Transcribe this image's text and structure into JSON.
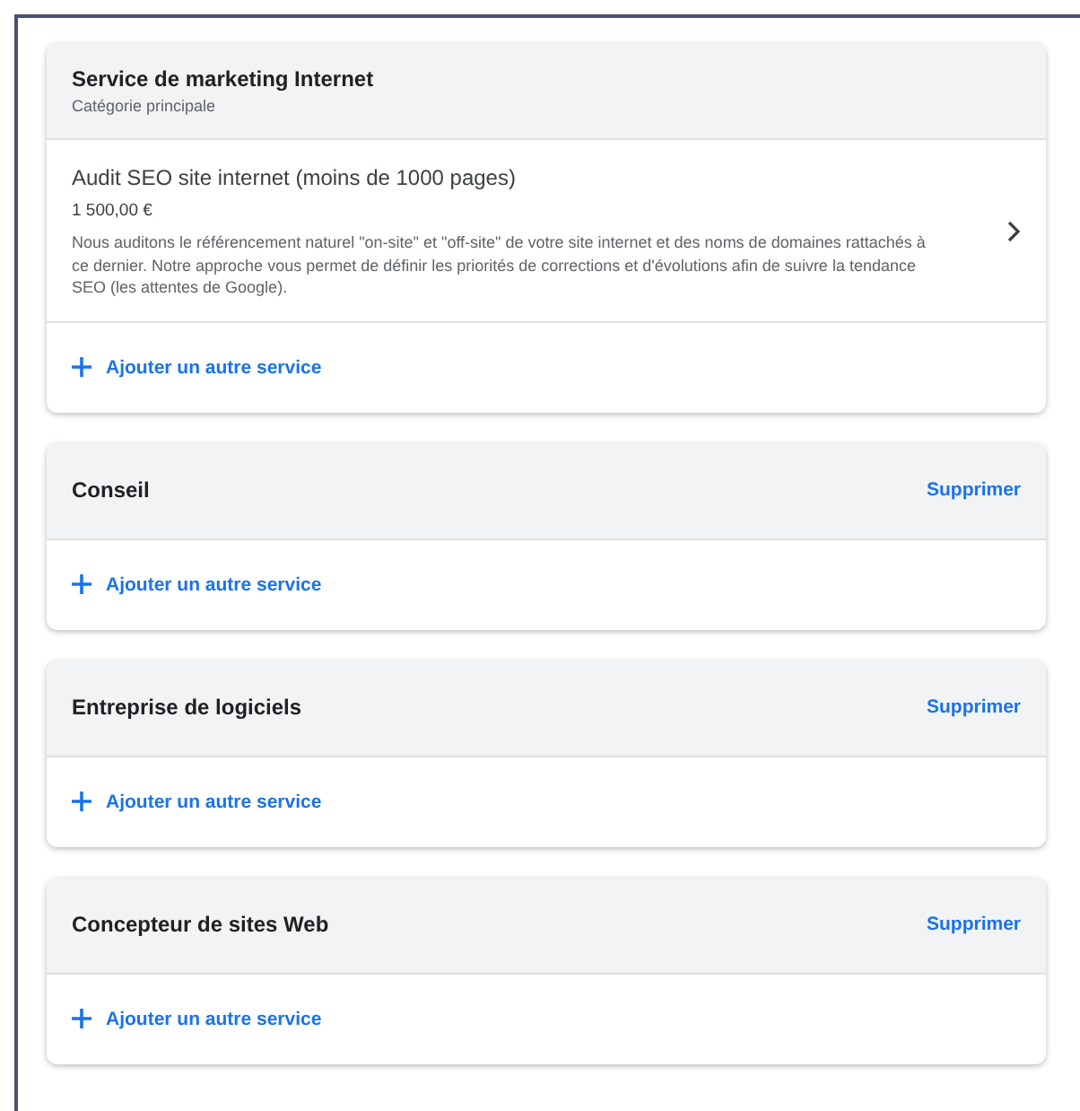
{
  "categories": [
    {
      "title": "Service de marketing Internet",
      "subtitle": "Catégorie principale",
      "services": [
        {
          "name": "Audit SEO site internet (moins de 1000 pages)",
          "price": "1 500,00 €",
          "description": "Nous auditons le référencement naturel \"on-site\" et \"off-site\" de votre site internet et des noms de domaines rattachés à ce dernier. Notre approche vous permet de définir les priorités de corrections et d'évolutions afin de suivre la tendance SEO (les attentes de Google)."
        }
      ],
      "add_label": "Ajouter un autre service"
    },
    {
      "title": "Conseil",
      "delete_label": "Supprimer",
      "add_label": "Ajouter un autre service"
    },
    {
      "title": "Entreprise de logiciels",
      "delete_label": "Supprimer",
      "add_label": "Ajouter un autre service"
    },
    {
      "title": "Concepteur de sites Web",
      "delete_label": "Supprimer",
      "add_label": "Ajouter un autre service"
    }
  ]
}
